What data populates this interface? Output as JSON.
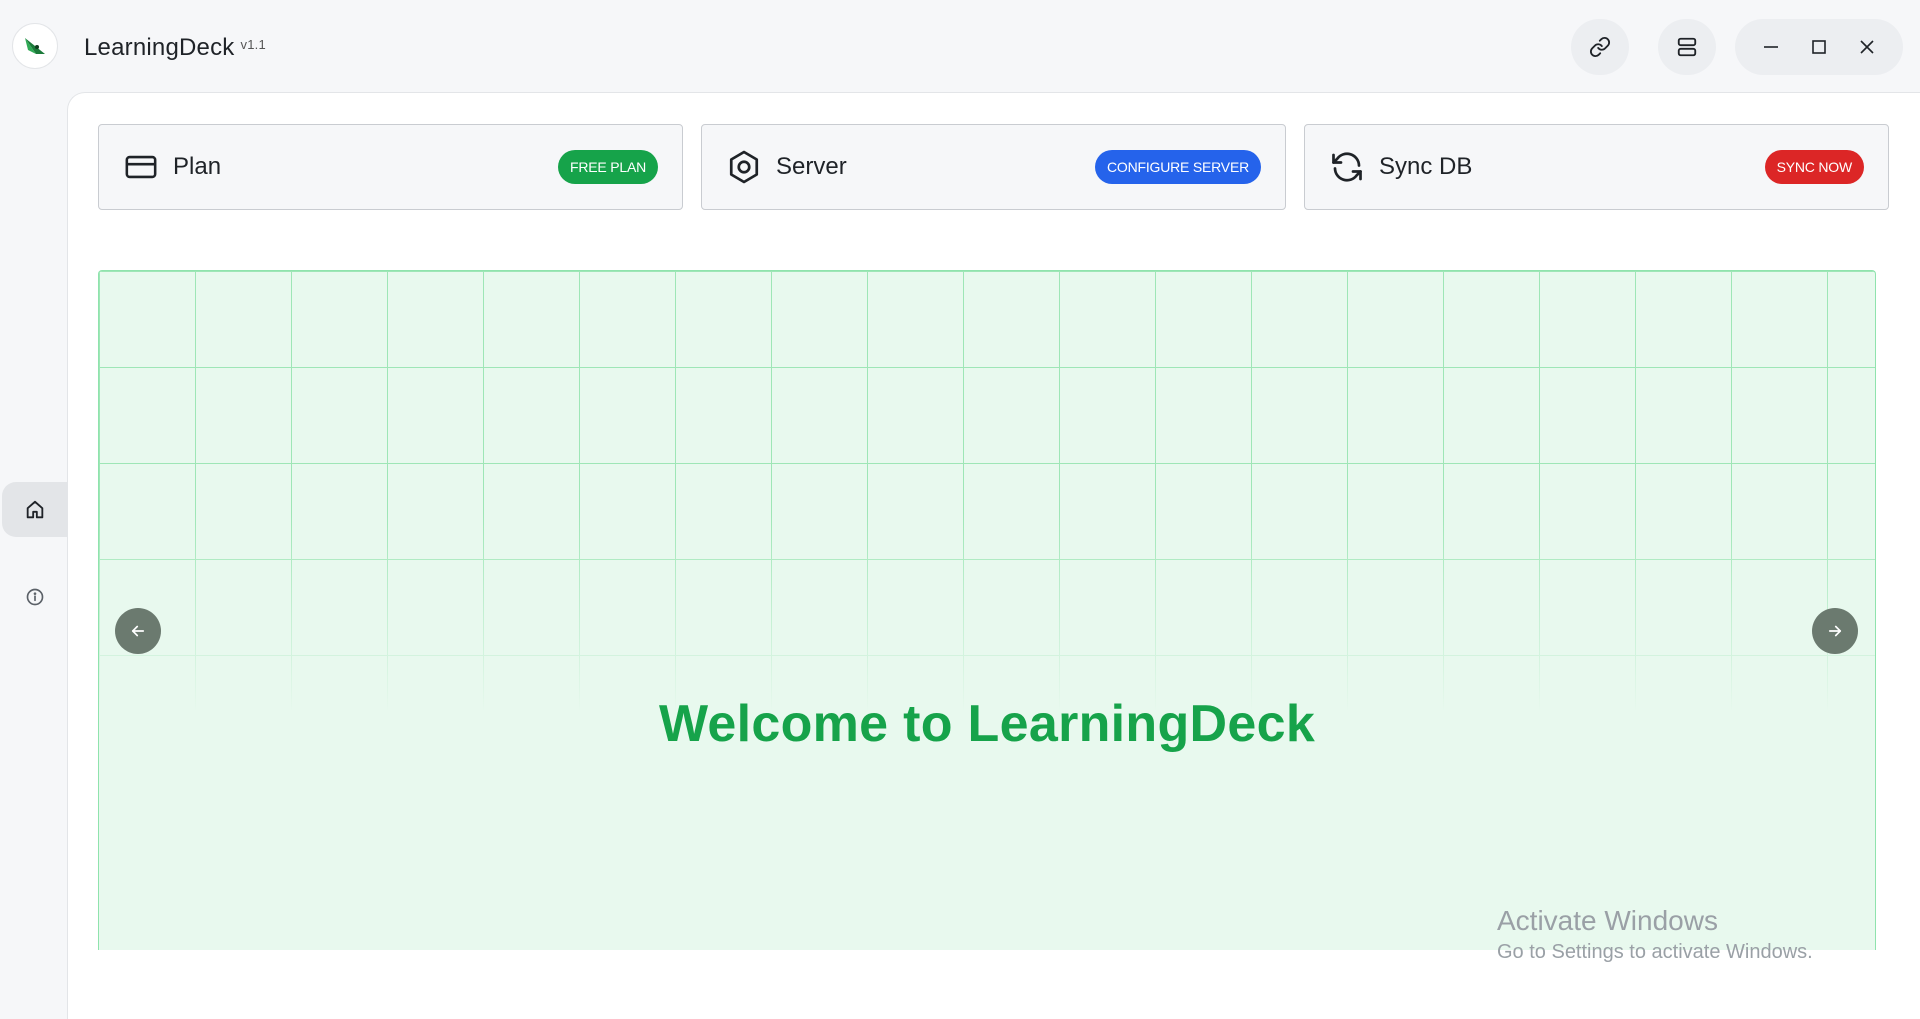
{
  "app": {
    "title": "LearningDeck",
    "version": "v1.1"
  },
  "titlebar": {
    "link_icon": "link-icon",
    "server_icon": "server-icon",
    "window_controls": [
      "minimize-icon",
      "maximize-icon",
      "close-icon"
    ]
  },
  "sidebar": {
    "items": [
      {
        "name": "home",
        "icon": "home-icon",
        "active": true
      },
      {
        "name": "about",
        "icon": "info-icon",
        "active": false
      }
    ]
  },
  "cards": [
    {
      "label": "Plan",
      "icon": "credit-card-icon",
      "action": "FREE PLAN",
      "color": "#16a34a"
    },
    {
      "label": "Server",
      "icon": "hexagon-settings-icon",
      "action": "CONFIGURE SERVER",
      "color": "#2563eb"
    },
    {
      "label": "Sync DB",
      "icon": "refresh-icon",
      "action": "SYNC NOW",
      "color": "#dc2626"
    }
  ],
  "hero": {
    "title": "Welcome to LearningDeck",
    "prev_icon": "arrow-left-icon",
    "next_icon": "arrow-right-icon",
    "background": "#e8f9ee",
    "accent": "#16a34a"
  },
  "watermark": {
    "title": "Activate Windows",
    "subtitle": "Go to Settings to activate Windows."
  }
}
